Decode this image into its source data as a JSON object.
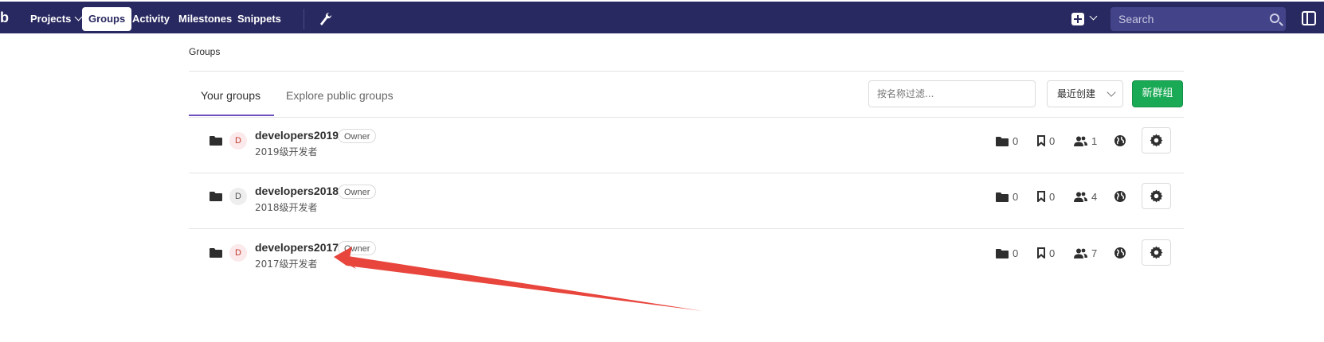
{
  "nav": {
    "logo": "b",
    "items": [
      {
        "label": "Projects",
        "has_caret": true
      },
      {
        "label": "Groups",
        "active": true
      },
      {
        "label": "Activity"
      },
      {
        "label": "Milestones"
      },
      {
        "label": "Snippets"
      }
    ],
    "search_placeholder": "Search"
  },
  "breadcrumb": "Groups",
  "tabs": [
    {
      "label": "Your groups",
      "active": true
    },
    {
      "label": "Explore public groups"
    }
  ],
  "filter_placeholder": "按名称过滤...",
  "sort_label": "最近创建",
  "new_group_label": "新群组",
  "groups": [
    {
      "initial": "D",
      "name": "developers2019",
      "role": "Owner",
      "description": "2019级开发者",
      "subgroups": "0",
      "projects": "0",
      "members": "1",
      "avatar_color": "#fbe9eb",
      "avatar_text_color": "#c0392b"
    },
    {
      "initial": "D",
      "name": "developers2018",
      "role": "Owner",
      "description": "2018级开发者",
      "subgroups": "0",
      "projects": "0",
      "members": "4",
      "avatar_color": "#eeeeee",
      "avatar_text_color": "#555555"
    },
    {
      "initial": "D",
      "name": "developers2017",
      "role": "Owner",
      "description": "2017级开发者",
      "subgroups": "0",
      "projects": "0",
      "members": "7",
      "avatar_color": "#fbe9eb",
      "avatar_text_color": "#c0392b"
    }
  ],
  "colors": {
    "navbar": "#292961",
    "accent": "#6b4fbb",
    "new_group": "#1aaa55",
    "annotation_arrow": "#e8453c"
  }
}
